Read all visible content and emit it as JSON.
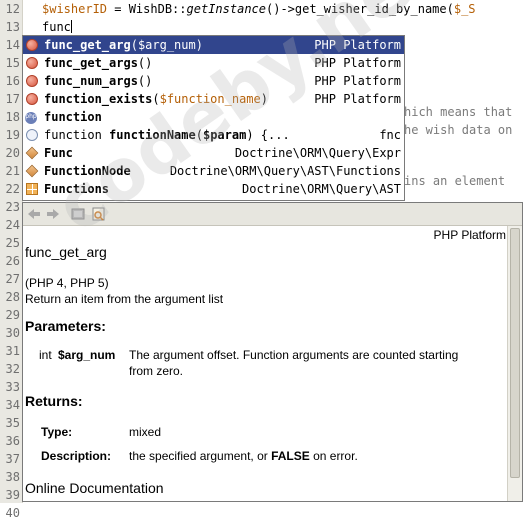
{
  "editor": {
    "line_numbers": [
      "12",
      "13",
      "14",
      "15",
      "16",
      "17",
      "18",
      "19",
      "20",
      "21",
      "22",
      "23",
      "24",
      "25",
      "26",
      "27",
      "28",
      "29",
      "30",
      "31",
      "32",
      "33",
      "34",
      "35",
      "36",
      "37",
      "38",
      "39",
      "40"
    ],
    "line12": {
      "var": "$wisherID",
      "mid": " = WishDB::",
      "method": "getInstance",
      "rest": "()->get_wisher_id_by_name(",
      "arg": "$_S"
    },
    "line13": "func",
    "comment_fragments": [
      "hich means that",
      "he wish data on",
      "ins an element"
    ]
  },
  "completion": {
    "items": [
      {
        "icon": "function-dot-icon",
        "name": "func_get_arg",
        "params": "$arg_num",
        "close": ")",
        "source": "PHP Platform",
        "selected": true
      },
      {
        "icon": "function-dot-icon",
        "name": "func_get_args",
        "params": "",
        "close": ")",
        "source": "PHP Platform",
        "selected": false
      },
      {
        "icon": "function-dot-icon",
        "name": "func_num_args",
        "params": "",
        "close": ")",
        "source": "PHP Platform",
        "selected": false
      },
      {
        "icon": "function-dot-icon",
        "name": "function_exists",
        "params": "$function_name",
        "close": ")",
        "source": "PHP Platform",
        "selected": false
      },
      {
        "icon": "php-keyword-icon",
        "name": "function",
        "params": "",
        "close": "",
        "source": "",
        "selected": false
      },
      {
        "icon": "code-template-icon",
        "prefix": "function ",
        "name": "functionName",
        "params": "$param",
        "close": ") {...",
        "source": "fnc",
        "selected": false
      },
      {
        "icon": "class-icon",
        "name": "Func",
        "params": "",
        "close": "",
        "source": "Doctrine\\ORM\\Query\\Expr",
        "selected": false
      },
      {
        "icon": "class-icon",
        "name": "FunctionNode",
        "params": "",
        "close": "",
        "source": "Doctrine\\ORM\\Query\\AST\\Functions",
        "selected": false
      },
      {
        "icon": "table-icon",
        "name": "Functions",
        "params": "",
        "close": "",
        "source": "Doctrine\\ORM\\Query\\AST",
        "selected": false
      }
    ]
  },
  "doc": {
    "platform": "PHP Platform",
    "title": "func_get_arg",
    "versions": "(PHP 4, PHP 5)",
    "summary": "Return an item from the argument list",
    "parameters_heading": "Parameters:",
    "param_type": "int",
    "param_name": "$arg_num",
    "param_desc_1": "The argument offset. Function arguments are counted starting",
    "param_desc_2": "from zero.",
    "returns_heading": "Returns:",
    "type_label": "Type:",
    "type_value": "mixed",
    "description_label": "Description:",
    "description_pre": "the specified argument, or ",
    "description_bold": "FALSE",
    "description_post": " on error.",
    "online_doc": "Online Documentation"
  },
  "watermark": "codeby.net"
}
